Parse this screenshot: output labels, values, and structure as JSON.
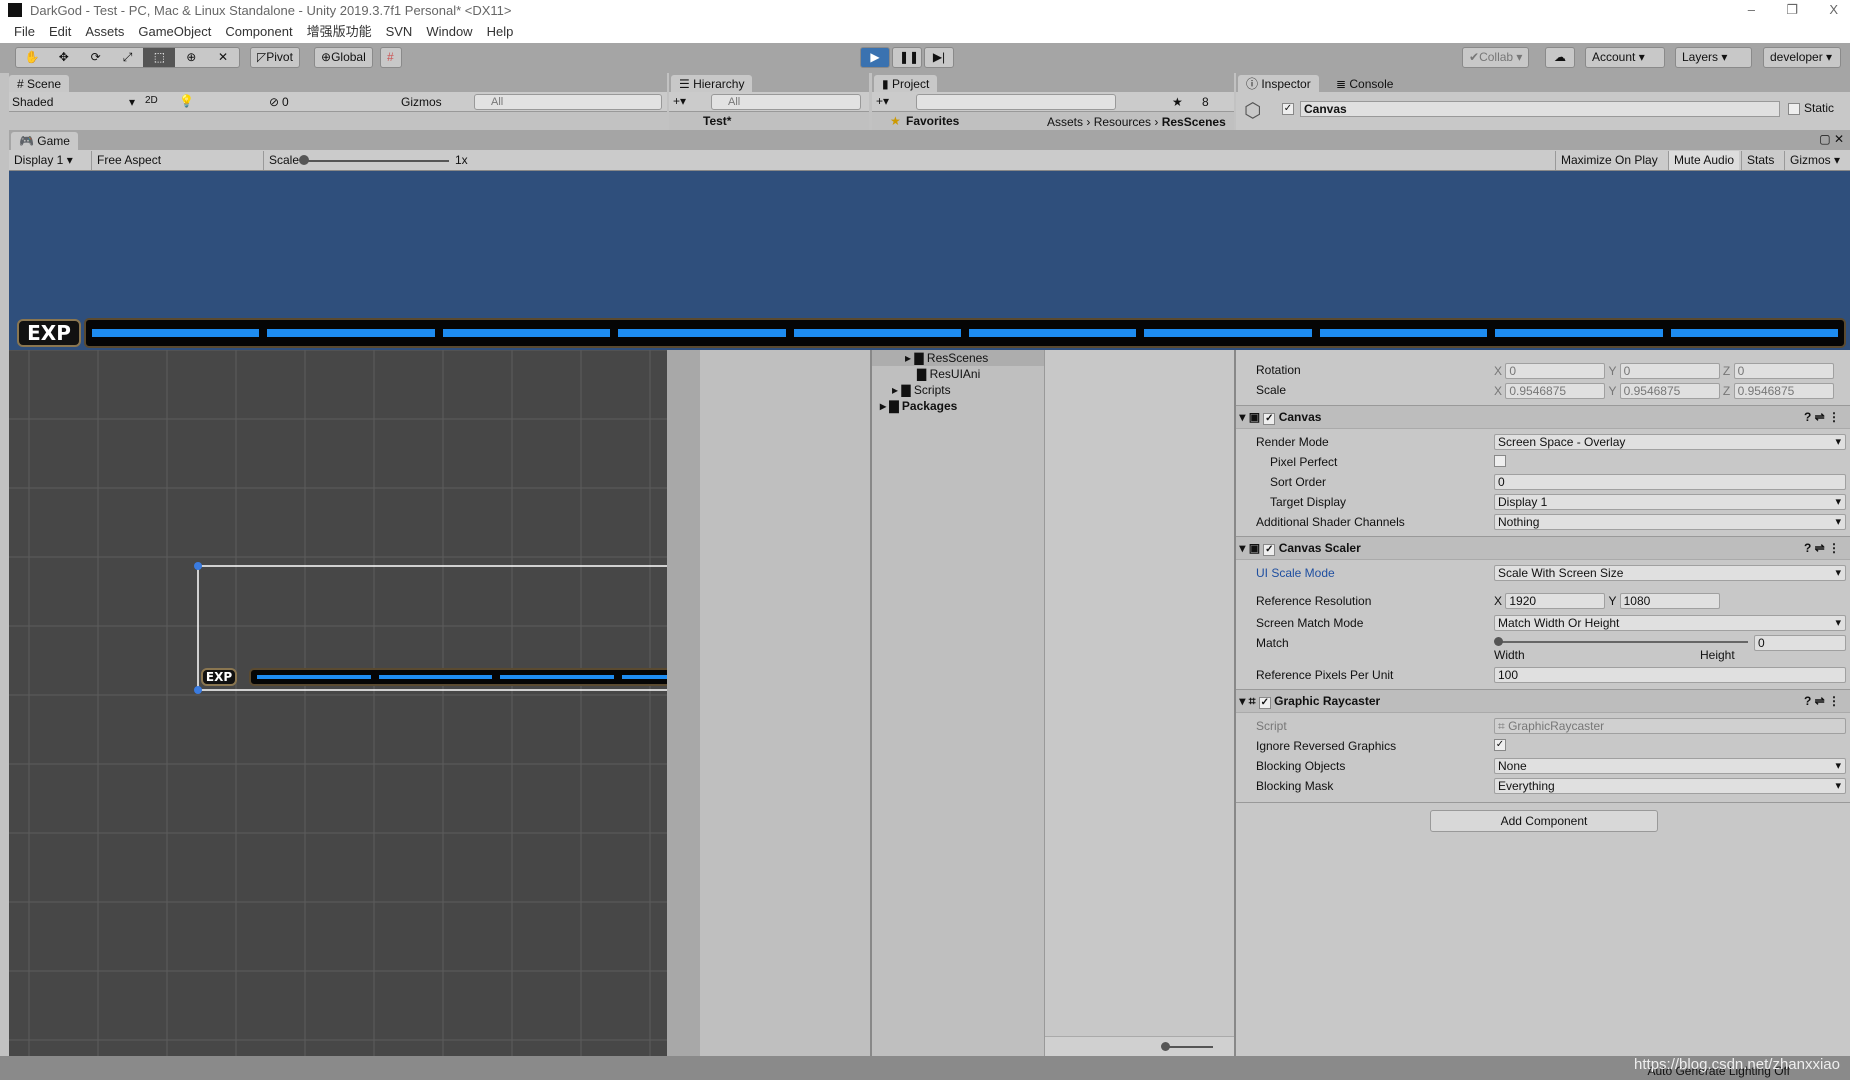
{
  "window": {
    "title": "DarkGod - Test - PC, Mac & Linux Standalone - Unity 2019.3.7f1 Personal* <DX11>",
    "minimize": "–",
    "restore": "❐",
    "close": "X"
  },
  "menu": [
    "File",
    "Edit",
    "Assets",
    "GameObject",
    "Component",
    "增强版功能",
    "SVN",
    "Window",
    "Help"
  ],
  "toolbar": {
    "pivot": "Pivot",
    "global": "Global",
    "collab": "Collab",
    "account": "Account",
    "layers": "Layers",
    "layout": "developer",
    "accent": "#3a72b0"
  },
  "scene": {
    "tab": "Scene",
    "shading": "Shaded",
    "mode2d": "2D",
    "hidden_count": "0",
    "gizmos": "Gizmos",
    "search_placeholder": "All",
    "exp_label": "EXP"
  },
  "hierarchy": {
    "tab": "Hierarchy",
    "search_placeholder": "All",
    "root": "Test*"
  },
  "project": {
    "tab": "Project",
    "hidden_count": "8",
    "favorites": "Favorites",
    "breadcrumb": [
      "Assets",
      "Resources",
      "ResScenes"
    ],
    "tree": [
      {
        "label": "ResScenes",
        "bold": false
      },
      {
        "label": "ResUIAni",
        "bold": false
      },
      {
        "label": "Scripts",
        "bold": false
      },
      {
        "label": "Packages",
        "bold": true
      }
    ]
  },
  "inspector": {
    "tab": "Inspector",
    "console_tab": "Console",
    "object_name": "Canvas",
    "static_label": "Static",
    "rotation": {
      "label": "Rotation",
      "x": "0",
      "y": "0",
      "z": "0"
    },
    "scale": {
      "label": "Scale",
      "x": "0.9546875",
      "y": "0.9546875",
      "z": "0.9546875"
    },
    "canvas": {
      "title": "Canvas",
      "render_mode_label": "Render Mode",
      "render_mode": "Screen Space - Overlay",
      "pixel_perfect_label": "Pixel Perfect",
      "sort_order_label": "Sort Order",
      "sort_order": "0",
      "target_display_label": "Target Display",
      "target_display": "Display 1",
      "shader_channels_label": "Additional Shader Channels",
      "shader_channels": "Nothing"
    },
    "scaler": {
      "title": "Canvas Scaler",
      "ui_scale_mode_label": "UI Scale Mode",
      "ui_scale_mode": "Scale With Screen Size",
      "ref_res_label": "Reference Resolution",
      "ref_x": "1920",
      "ref_y": "1080",
      "match_mode_label": "Screen Match Mode",
      "match_mode": "Match Width Or Height",
      "match_label": "Match",
      "match_value": "0",
      "width_label": "Width",
      "height_label": "Height",
      "ppu_label": "Reference Pixels Per Unit",
      "ppu": "100"
    },
    "raycaster": {
      "title": "Graphic Raycaster",
      "script_label": "Script",
      "script": "GraphicRaycaster",
      "ignore_label": "Ignore Reversed Graphics",
      "blocking_objects_label": "Blocking Objects",
      "blocking_objects": "None",
      "blocking_mask_label": "Blocking Mask",
      "blocking_mask": "Everything"
    },
    "add_component": "Add Component"
  },
  "game": {
    "tab": "Game",
    "display": "Display 1",
    "aspect": "Free Aspect",
    "scale_label": "Scale",
    "scale_value": "1x",
    "maximize": "Maximize On Play",
    "mute": "Mute Audio",
    "stats": "Stats",
    "gizmos": "Gizmos",
    "exp_label": "EXP",
    "exp_segments": 10,
    "bg": "#2f4f7c",
    "bar_color": "#1e8cf0"
  },
  "status": {
    "lighting": "Auto Generate Lighting Off",
    "watermark": "https://blog.csdn.net/zhanxxiao"
  }
}
